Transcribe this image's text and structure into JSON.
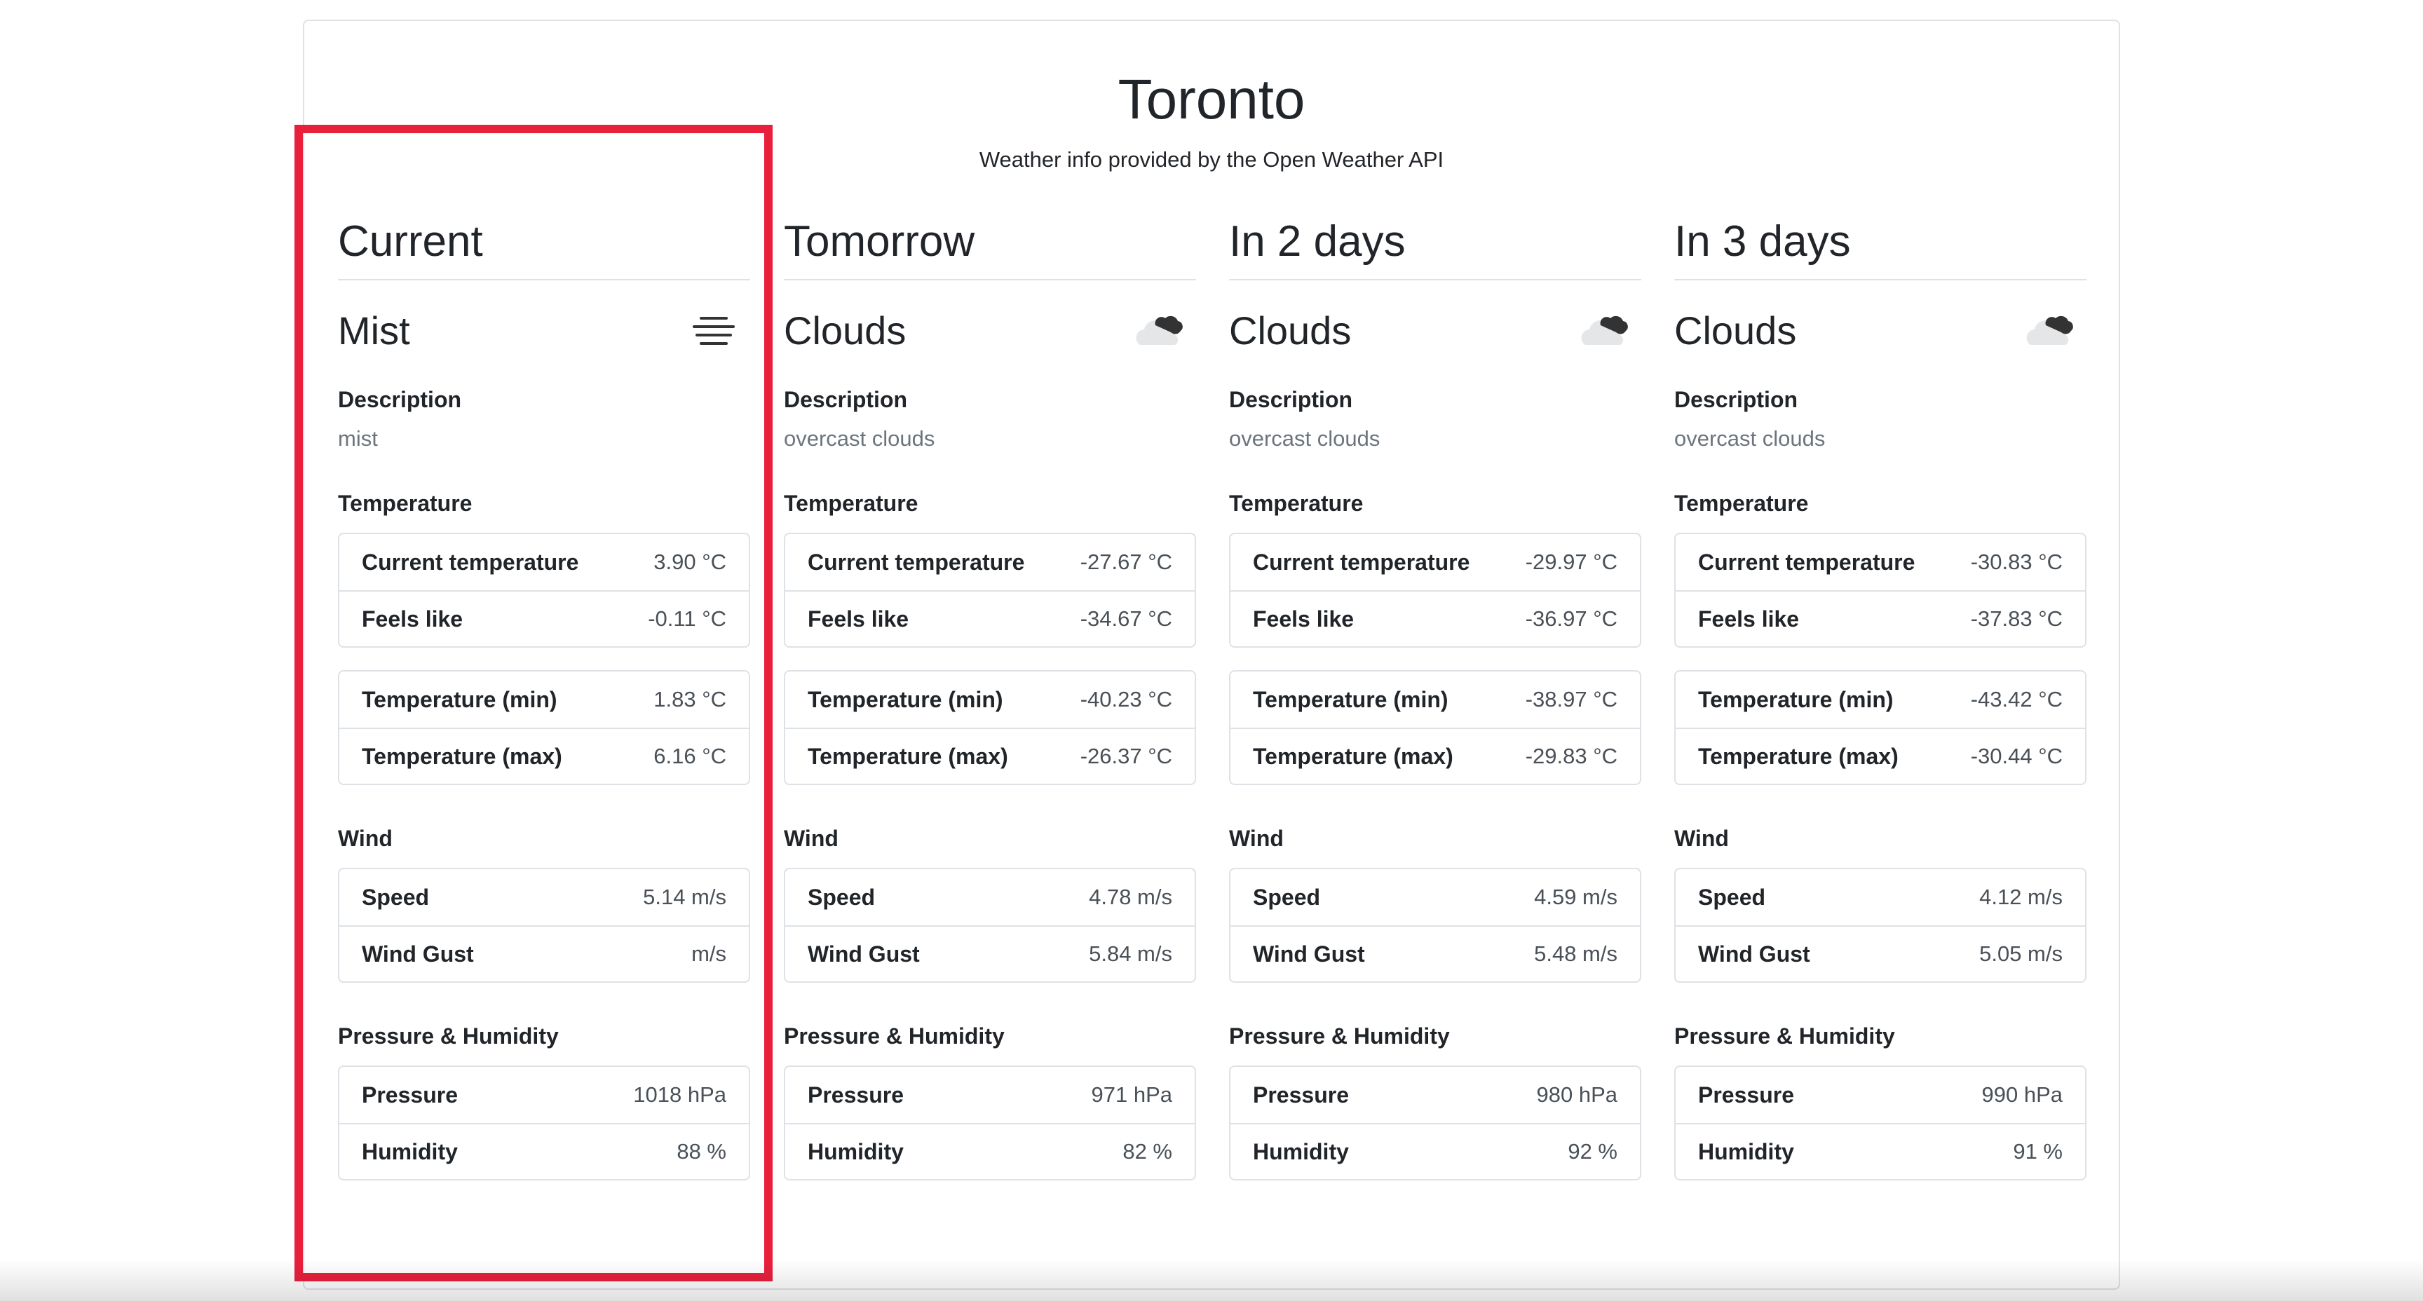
{
  "header": {
    "city": "Toronto",
    "credit": "Weather info provided by the Open Weather API"
  },
  "accent_color": "#e8203c",
  "days": [
    {
      "title": "Current",
      "condition": "Mist",
      "icon": "mist-icon",
      "description_label": "Description",
      "description": "mist",
      "temperature_label": "Temperature",
      "current_temp_label": "Current temperature",
      "current_temp": "3.90 °C",
      "feels_like_label": "Feels like",
      "feels_like": "-0.11 °C",
      "temp_min_label": "Temperature (min)",
      "temp_min": "1.83 °C",
      "temp_max_label": "Temperature (max)",
      "temp_max": "6.16 °C",
      "wind_label": "Wind",
      "speed_label": "Speed",
      "speed": "5.14 m/s",
      "gust_label": "Wind Gust",
      "gust": "m/s",
      "ph_label": "Pressure & Humidity",
      "pressure_label": "Pressure",
      "pressure": "1018 hPa",
      "humidity_label": "Humidity",
      "humidity": "88 %"
    },
    {
      "title": "Tomorrow",
      "condition": "Clouds",
      "icon": "clouds-icon",
      "description_label": "Description",
      "description": "overcast clouds",
      "temperature_label": "Temperature",
      "current_temp_label": "Current temperature",
      "current_temp": "-27.67 °C",
      "feels_like_label": "Feels like",
      "feels_like": "-34.67 °C",
      "temp_min_label": "Temperature (min)",
      "temp_min": "-40.23 °C",
      "temp_max_label": "Temperature (max)",
      "temp_max": "-26.37 °C",
      "wind_label": "Wind",
      "speed_label": "Speed",
      "speed": "4.78 m/s",
      "gust_label": "Wind Gust",
      "gust": "5.84 m/s",
      "ph_label": "Pressure & Humidity",
      "pressure_label": "Pressure",
      "pressure": "971 hPa",
      "humidity_label": "Humidity",
      "humidity": "82 %"
    },
    {
      "title": "In 2 days",
      "condition": "Clouds",
      "icon": "clouds-icon",
      "description_label": "Description",
      "description": "overcast clouds",
      "temperature_label": "Temperature",
      "current_temp_label": "Current temperature",
      "current_temp": "-29.97 °C",
      "feels_like_label": "Feels like",
      "feels_like": "-36.97 °C",
      "temp_min_label": "Temperature (min)",
      "temp_min": "-38.97 °C",
      "temp_max_label": "Temperature (max)",
      "temp_max": "-29.83 °C",
      "wind_label": "Wind",
      "speed_label": "Speed",
      "speed": "4.59 m/s",
      "gust_label": "Wind Gust",
      "gust": "5.48 m/s",
      "ph_label": "Pressure & Humidity",
      "pressure_label": "Pressure",
      "pressure": "980 hPa",
      "humidity_label": "Humidity",
      "humidity": "92 %"
    },
    {
      "title": "In 3 days",
      "condition": "Clouds",
      "icon": "clouds-icon",
      "description_label": "Description",
      "description": "overcast clouds",
      "temperature_label": "Temperature",
      "current_temp_label": "Current temperature",
      "current_temp": "-30.83 °C",
      "feels_like_label": "Feels like",
      "feels_like": "-37.83 °C",
      "temp_min_label": "Temperature (min)",
      "temp_min": "-43.42 °C",
      "temp_max_label": "Temperature (max)",
      "temp_max": "-30.44 °C",
      "wind_label": "Wind",
      "speed_label": "Speed",
      "speed": "4.12 m/s",
      "gust_label": "Wind Gust",
      "gust": "5.05 m/s",
      "ph_label": "Pressure & Humidity",
      "pressure_label": "Pressure",
      "pressure": "990 hPa",
      "humidity_label": "Humidity",
      "humidity": "91 %"
    }
  ]
}
